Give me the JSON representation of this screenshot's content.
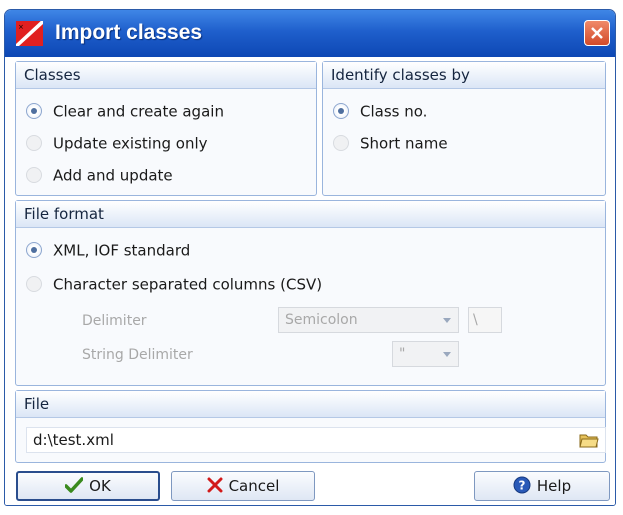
{
  "window": {
    "title": "Import classes",
    "icons": {
      "app": "app-flag-icon",
      "close": "close-icon"
    }
  },
  "classes_group": {
    "header": "Classes",
    "options": [
      {
        "label": "Clear and create again",
        "checked": true
      },
      {
        "label": "Update existing only",
        "checked": false
      },
      {
        "label": "Add and update",
        "checked": false
      }
    ]
  },
  "identify_group": {
    "header": "Identify classes by",
    "options": [
      {
        "label": "Class no.",
        "checked": true
      },
      {
        "label": "Short name",
        "checked": false
      }
    ]
  },
  "file_format_group": {
    "header": "File format",
    "options": [
      {
        "label": "XML, IOF standard",
        "checked": true
      },
      {
        "label": "Character separated columns (CSV)",
        "checked": false
      }
    ],
    "delimiter_label": "Delimiter",
    "delimiter_value": "Semicolon",
    "delimiter_char": "\\",
    "string_delimiter_label": "String Delimiter",
    "string_delimiter_value": "\""
  },
  "file_group": {
    "header": "File",
    "path": "d:\\test.xml",
    "browse_icon": "folder-open-icon"
  },
  "buttons": {
    "ok": "OK",
    "cancel": "Cancel",
    "help": "Help",
    "icons": {
      "ok": "checkmark-icon",
      "cancel": "x-mark-icon",
      "help": "help-icon"
    }
  },
  "colors": {
    "titlebar": "#1f5fcc",
    "group_border": "#9ab5dd",
    "ok_icon": "#3a8a1e",
    "cancel_icon": "#d21a1a",
    "help_icon": "#2a5ab8"
  }
}
